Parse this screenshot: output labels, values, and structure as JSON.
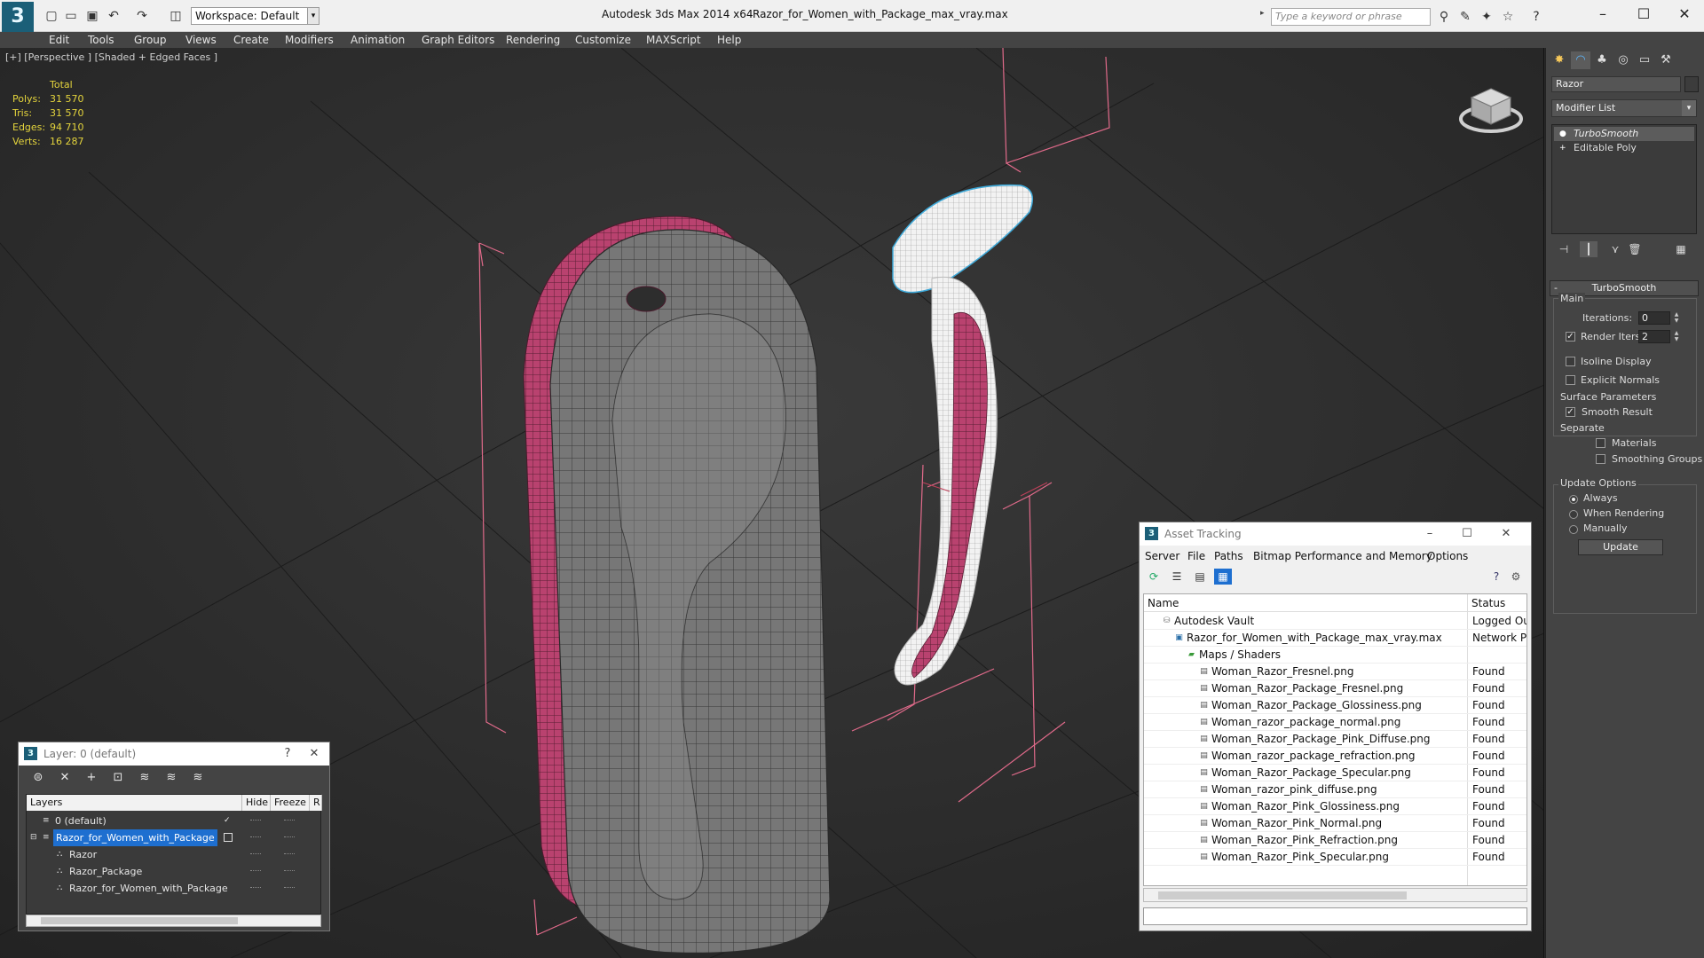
{
  "window": {
    "app_title": "Autodesk 3ds Max  2014 x64",
    "file_title": "Razor_for_Women_with_Package_max_vray.max",
    "workspace_label": "Workspace: Default",
    "search_placeholder": "Type a keyword or phrase"
  },
  "menu": [
    "Edit",
    "Tools",
    "Group",
    "Views",
    "Create",
    "Modifiers",
    "Animation",
    "Graph Editors",
    "Rendering",
    "Customize",
    "MAXScript",
    "Help"
  ],
  "viewport": {
    "label": "[+] [Perspective ] [Shaded + Edged Faces ]",
    "stats": {
      "header": "Total",
      "rows": [
        {
          "label": "Polys:",
          "value": "31 570"
        },
        {
          "label": "Tris:",
          "value": "31 570"
        },
        {
          "label": "Edges:",
          "value": "94 710"
        },
        {
          "label": "Verts:",
          "value": "16 287"
        }
      ]
    }
  },
  "command_panel": {
    "object_name": "Razor",
    "modifier_list": "Modifier List",
    "stack": [
      {
        "label": "TurboSmooth",
        "selected": true
      },
      {
        "label": "Editable Poly",
        "selected": false
      }
    ],
    "turbosmooth": {
      "title": "TurboSmooth",
      "main_label": "Main",
      "iterations_label": "Iterations:",
      "iterations_value": "0",
      "render_iters_label": "Render Iters:",
      "render_iters_value": "2",
      "isoline_label": "Isoline Display",
      "explicit_normals_label": "Explicit Normals",
      "surface_label": "Surface Parameters",
      "smooth_result_label": "Smooth Result",
      "separate_label": "Separate",
      "materials_label": "Materials",
      "smoothing_groups_label": "Smoothing Groups",
      "update_options_label": "Update Options",
      "always_label": "Always",
      "when_rendering_label": "When Rendering",
      "manually_label": "Manually",
      "update_button": "Update"
    }
  },
  "layer_window": {
    "title": "Layer: 0 (default)",
    "help": "?",
    "columns": [
      "Layers",
      "Hide",
      "Freeze",
      "R"
    ],
    "rows": [
      {
        "name": "0 (default)",
        "indent": 0,
        "selected": false
      },
      {
        "name": "Razor_for_Women_with_Package",
        "indent": 0,
        "selected": true
      },
      {
        "name": "Razor",
        "indent": 1,
        "selected": false
      },
      {
        "name": "Razor_Package",
        "indent": 1,
        "selected": false
      },
      {
        "name": "Razor_for_Women_with_Package",
        "indent": 1,
        "selected": false
      }
    ]
  },
  "asset_window": {
    "title": "Asset Tracking",
    "menu": [
      "Server",
      "File",
      "Paths",
      "Bitmap Performance and Memory",
      "Options"
    ],
    "columns": [
      "Name",
      "Status"
    ],
    "rows": [
      {
        "name": "Autodesk Vault",
        "status": "Logged Ou",
        "indent": 0,
        "icon": "vault"
      },
      {
        "name": "Razor_for_Women_with_Package_max_vray.max",
        "status": "Network P",
        "indent": 1,
        "icon": "max"
      },
      {
        "name": "Maps / Shaders",
        "status": "",
        "indent": 2,
        "icon": "folder"
      },
      {
        "name": "Woman_Razor_Fresnel.png",
        "status": "Found",
        "indent": 3,
        "icon": "file"
      },
      {
        "name": "Woman_Razor_Package_Fresnel.png",
        "status": "Found",
        "indent": 3,
        "icon": "file"
      },
      {
        "name": "Woman_Razor_Package_Glossiness.png",
        "status": "Found",
        "indent": 3,
        "icon": "file"
      },
      {
        "name": "Woman_razor_package_normal.png",
        "status": "Found",
        "indent": 3,
        "icon": "file"
      },
      {
        "name": "Woman_Razor_Package_Pink_Diffuse.png",
        "status": "Found",
        "indent": 3,
        "icon": "file"
      },
      {
        "name": "Woman_razor_package_refraction.png",
        "status": "Found",
        "indent": 3,
        "icon": "file"
      },
      {
        "name": "Woman_Razor_Package_Specular.png",
        "status": "Found",
        "indent": 3,
        "icon": "file"
      },
      {
        "name": "Woman_razor_pink_diffuse.png",
        "status": "Found",
        "indent": 3,
        "icon": "file"
      },
      {
        "name": "Woman_Razor_Pink_Glossiness.png",
        "status": "Found",
        "indent": 3,
        "icon": "file"
      },
      {
        "name": "Woman_Razor_Pink_Normal.png",
        "status": "Found",
        "indent": 3,
        "icon": "file"
      },
      {
        "name": "Woman_Razor_Pink_Refraction.png",
        "status": "Found",
        "indent": 3,
        "icon": "file"
      },
      {
        "name": "Woman_Razor_Pink_Specular.png",
        "status": "Found",
        "indent": 3,
        "icon": "file"
      }
    ]
  },
  "colors": {
    "stats_text": "#e4d43c",
    "selection_blue": "#1e6fd0",
    "pink_mesh": "#b9426f",
    "bbox_lines": "#e06a8a"
  }
}
